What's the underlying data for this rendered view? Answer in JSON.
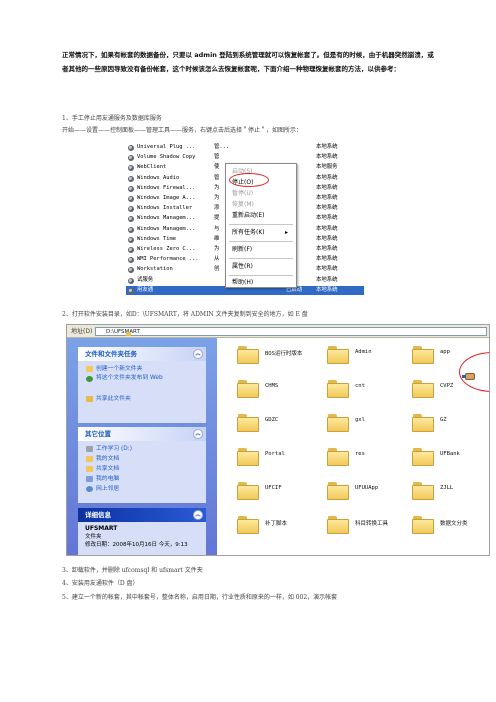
{
  "intro": "正常情况下，如果有帐套的数据备份，只要以 admin 登陆到系统管理就可以恢复帐套了。但是有的时候，由于机器突然崩溃，或者其他的一些原因导致没有备份帐套，这个时候该怎么去恢复帐套呢，下面介绍一种物理恢复帐套的方法，以供参考：",
  "steps": {
    "s1": "1、手工停止用友通服务及数据库服务",
    "s1b": "开始——设置——控制面板——管理工具——服务，右键点击后选择＂停止＂，如图所示：",
    "s2": "2、打开软件安装目录，如D：\\UFSMART，将 ADMIN 文件夹复制到安全的地方，如 E 盘",
    "s3": "3、卸载软件，并删除 ufcomsql 和 ufsmart 文件夹",
    "s4": "4、安装用友通软件（D 盘）",
    "s5": "5、建立一个新的帐套，其中帐套号，整体名称，启用日期，行业性质和原来的一样，如 002，演示帐套"
  },
  "services": [
    {
      "name": "Universal Plug ...",
      "desc": "管...",
      "status": "",
      "type": "手动",
      "logon": "本地系统",
      "icon": "gear-icon"
    },
    {
      "name": "Volume Shadow Copy",
      "desc": "管",
      "status": "",
      "type": "手动",
      "logon": "本地系统",
      "icon": "gear-icon"
    },
    {
      "name": "WebClient",
      "desc": "使",
      "status": "",
      "type": "",
      "logon": "本地服务",
      "icon": "gear-icon"
    },
    {
      "name": "Windows Audio",
      "desc": "管",
      "status": "",
      "type": "",
      "logon": "本地系统",
      "icon": "gear-icon"
    },
    {
      "name": "Windows Firewal...",
      "desc": "为",
      "status": "",
      "type": "",
      "logon": "本地系统",
      "icon": "gear-icon"
    },
    {
      "name": "Windows Image A...",
      "desc": "为",
      "status": "",
      "type": "",
      "logon": "本地系统",
      "icon": "gear-icon"
    },
    {
      "name": "Windows Installer",
      "desc": "添",
      "status": "",
      "type": "",
      "logon": "本地系统",
      "icon": "gear-icon"
    },
    {
      "name": "Windows Managem...",
      "desc": "提",
      "status": "",
      "type": "",
      "logon": "本地系统",
      "icon": "gear-icon"
    },
    {
      "name": "Windows Managem...",
      "desc": "与",
      "status": "",
      "type": "",
      "logon": "本地系统",
      "icon": "gear-icon"
    },
    {
      "name": "Windows Time",
      "desc": "维",
      "status": "",
      "type": "",
      "logon": "本地系统",
      "icon": "gear-icon"
    },
    {
      "name": "Wireless Zero C...",
      "desc": "为",
      "status": "",
      "type": "",
      "logon": "本地系统",
      "icon": "gear-icon"
    },
    {
      "name": "WMI Performance ...",
      "desc": "从",
      "status": "",
      "type": "",
      "logon": "本地系统",
      "icon": "gear-icon"
    },
    {
      "name": "Workstation",
      "desc": "创",
      "status": "",
      "type": "",
      "logon": "本地系统",
      "icon": "gear-icon"
    },
    {
      "name": "试服务",
      "desc": "",
      "status": "",
      "type": "",
      "logon": "本地系统",
      "icon": "gear-icon"
    },
    {
      "name": "用友通",
      "desc": "",
      "status": "已启动",
      "type": "自动",
      "logon": "本地系统",
      "icon": "gear-icon"
    }
  ],
  "context_menu": {
    "start": "启动(S)",
    "stop": "停止(O)",
    "pause": "暂停(U)",
    "resume": "恢复(M)",
    "restart": "重新启动(E)",
    "all_tasks": "所有任务(K)",
    "refresh": "刷新(F)",
    "properties": "属性(R)",
    "help": "帮助(H)"
  },
  "explorer": {
    "address_label": "地址(D)",
    "address_value": "D:\\UFSMART",
    "tasks_title": "文件和文件夹任务",
    "tasks": [
      "创建一个新文件夹",
      "将这个文件夹发布到 Web",
      "共享此文件夹"
    ],
    "other_title": "其它位置",
    "other": [
      "工作学习 (D:)",
      "我的文档",
      "共享文档",
      "我的电脑",
      "网上邻居"
    ],
    "details_title": "详细信息",
    "details_name": "UFSMART",
    "details_type": "文件夹",
    "details_modified": "修改日期：2008年10月16日 今天，9:13",
    "folders": [
      "BOS运行时版本",
      "Admin",
      "app",
      "CHMS",
      "cnt",
      "CVPZ",
      "GDZC",
      "gxl",
      "GZ",
      "Portal",
      "res",
      "UFBank",
      "UFCIF",
      "UFUUApp",
      "ZJLL",
      "补丁脚本",
      "科目转换工具",
      "数据文分类"
    ]
  },
  "colors": {
    "highlight": "#316ac5",
    "annotation": "#e02020",
    "pane_blue": "#6375d6"
  }
}
